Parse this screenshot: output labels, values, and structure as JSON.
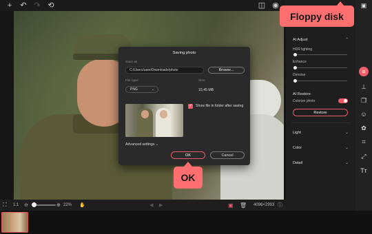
{
  "toolbar": {
    "icons": [
      "plus-icon",
      "undo-icon",
      "redo-icon",
      "reset-icon",
      "compare-icon",
      "eye-icon",
      "save-icon"
    ],
    "glyphs": {
      "add": "+",
      "undo": "↶",
      "redo": "↷",
      "reset": "⟲",
      "compare": "◫",
      "eye": "◉",
      "save": "▣"
    }
  },
  "annotations": {
    "floppy_label": "Floppy disk",
    "ok_label": "OK"
  },
  "dialog": {
    "title": "Saving photo",
    "save_as_label": "Save as",
    "path_value": "C:/Users/user/Downloads/photo",
    "browse_label": "Browse...",
    "file_type_label": "File type:",
    "file_type_value": "PNG",
    "size_label": "Size:",
    "size_value": "15,45 MB",
    "show_in_folder_label": "Show file in folder after saving",
    "show_in_folder_checked": true,
    "advanced_label": "Advanced settings",
    "ok_label": "OK",
    "cancel_label": "Cancel"
  },
  "right_panel": {
    "ai_adjust": {
      "title": "AI Adjust",
      "hdr_label": "HDR lighting",
      "enhance_label": "Enhance",
      "denoise_label": "Denoise",
      "hdr_value": 0,
      "enhance_value": 0,
      "denoise_value": 0
    },
    "ai_restore": {
      "title": "AI Restore",
      "colorize_label": "Colorize photo",
      "colorize_on": true,
      "restore_label": "Restore"
    },
    "sections": [
      "Light",
      "Color",
      "Detail"
    ]
  },
  "bottom_bar": {
    "fit_label": "1:1",
    "zoom_value": "22%",
    "dimensions": "4096×2993"
  },
  "colors": {
    "accent": "#f05a68",
    "callout": "#ff6f6f"
  }
}
